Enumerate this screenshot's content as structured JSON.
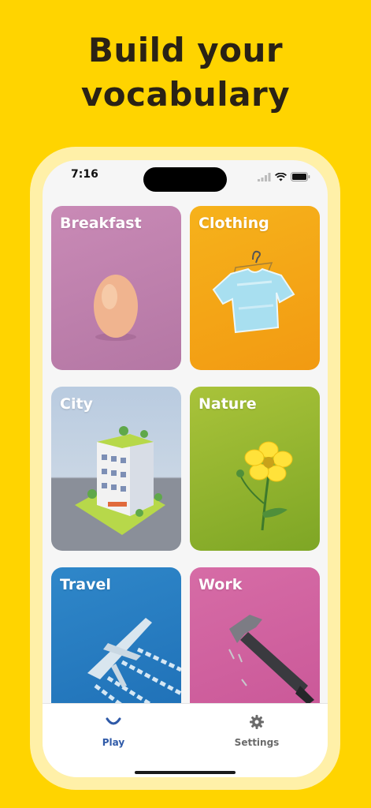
{
  "headline": "Build your vocabulary",
  "status_bar": {
    "time": "7:16",
    "icons": [
      "signal-icon",
      "wifi-icon",
      "battery-icon"
    ]
  },
  "categories": [
    {
      "label": "Breakfast",
      "color": "#c98ab6"
    },
    {
      "label": "Clothing",
      "color": "#f6b21b"
    },
    {
      "label": "City",
      "color": "#b9cbe0"
    },
    {
      "label": "Nature",
      "color": "#a9c33a"
    },
    {
      "label": "Travel",
      "color": "#2f87c9"
    },
    {
      "label": "Work",
      "color": "#d66ca6"
    }
  ],
  "tab_bar": {
    "play_label": "Play",
    "settings_label": "Settings",
    "active_tab": "Play",
    "active_color": "#2f5aa8"
  },
  "colors": {
    "background": "#FFD400",
    "phone_frame": "#FFF0A8"
  }
}
